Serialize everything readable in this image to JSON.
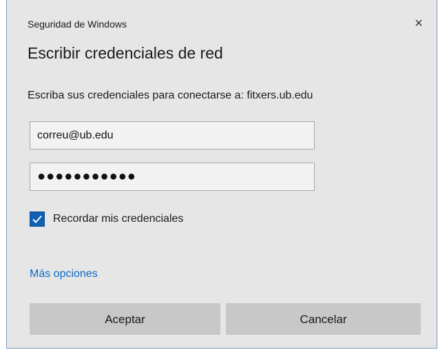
{
  "window": {
    "caption": "Seguridad de Windows",
    "close_icon": "×"
  },
  "dialog": {
    "heading": "Escribir credenciales de red",
    "description": "Escriba sus credenciales para conectarse a: fitxers.ub.edu",
    "username_value": "correu@ub.edu",
    "password_masked": "●●●●●●●●●●●",
    "remember_label": "Recordar mis credenciales",
    "remember_checked": true,
    "more_options": "Más opciones",
    "ok_label": "Aceptar",
    "cancel_label": "Cancelar"
  },
  "colors": {
    "background": "#e6e6e6",
    "accent": "#0f5fb3",
    "link": "#0b6ac4",
    "button": "#c8c8c8"
  }
}
